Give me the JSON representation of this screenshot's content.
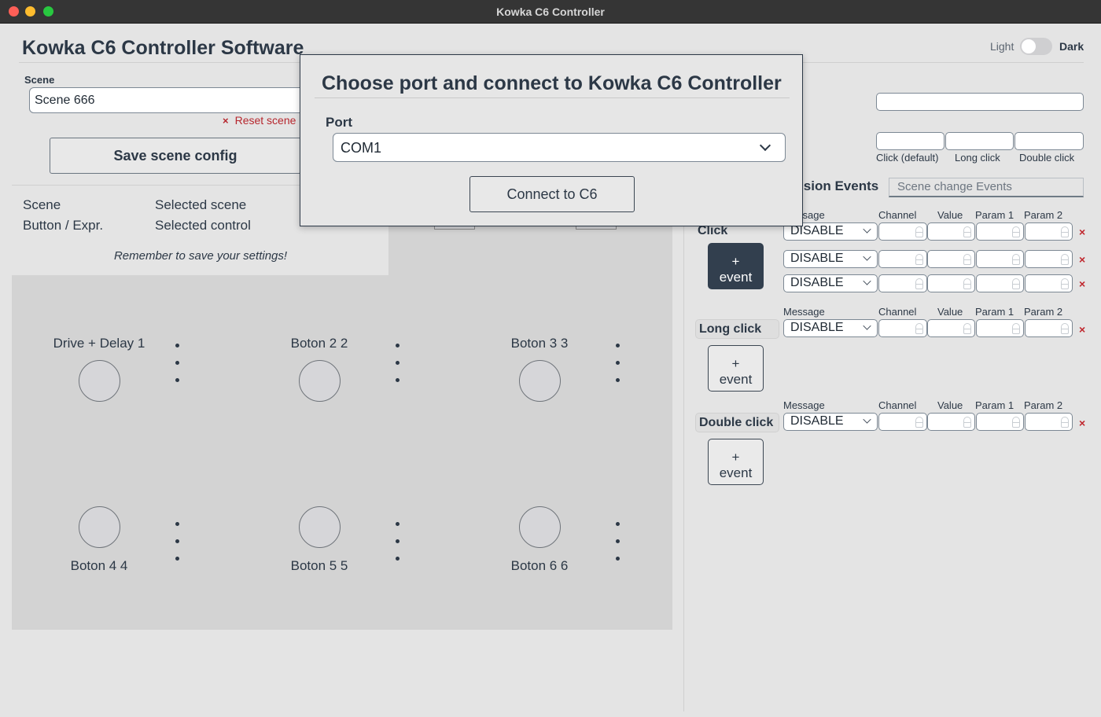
{
  "window": {
    "title": "Kowka C6 Controller"
  },
  "app": {
    "title": "Kowka C6 Controller Software"
  },
  "scene": {
    "label": "Scene",
    "value": "Scene 666",
    "reset_label": "Reset scene",
    "save_label": "Save scene config"
  },
  "info": {
    "scene_key": "Scene",
    "scene_value": "Selected scene",
    "control_key": "Button / Expr.",
    "control_value": "Selected control",
    "reminder": "Remember to save your settings!"
  },
  "buttons": [
    {
      "label": "Drive + Delay 1"
    },
    {
      "label": "Boton 2 2"
    },
    {
      "label": "Boton 3 3"
    },
    {
      "label": "Boton 4 4"
    },
    {
      "label": "Boton 5 5"
    },
    {
      "label": "Boton 6 6"
    }
  ],
  "theme": {
    "light_label": "Light",
    "dark_label": "Dark"
  },
  "click_types": {
    "click": "Click (default)",
    "long": "Long click",
    "double": "Double click"
  },
  "tabs": {
    "active": "sion Events",
    "inactive": "Scene change Events"
  },
  "columns": {
    "message": "Message",
    "channel": "Channel",
    "value": "Value",
    "param1": "Param 1",
    "param2": "Param 2"
  },
  "events": {
    "click_label": "Click",
    "long_label": "Long click",
    "double_label": "Double click",
    "add_plus": "+",
    "add_text": "event",
    "message_value": "DISABLE",
    "delete_symbol": "×"
  },
  "modal": {
    "title": "Choose port and connect to Kowka C6 Controller",
    "port_label": "Port",
    "port_value": "COM1",
    "connect_label": "Connect to C6"
  }
}
